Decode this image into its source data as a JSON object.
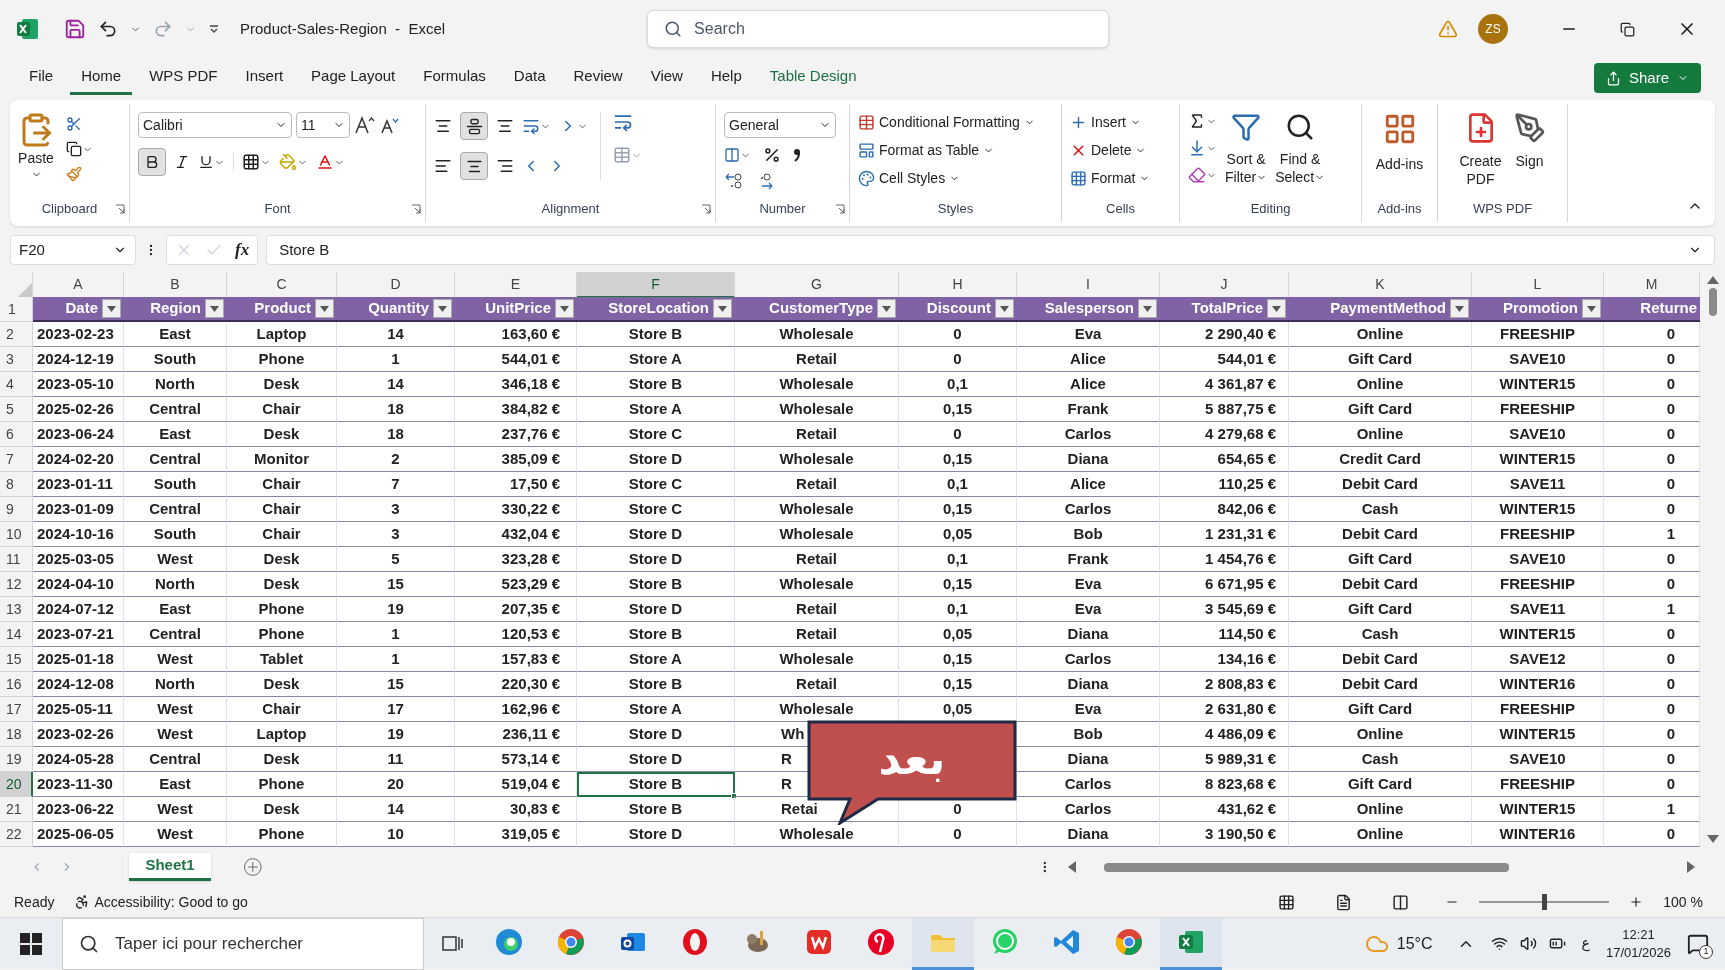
{
  "window": {
    "title": "Product-Sales-Region  -  Excel"
  },
  "search": {
    "placeholder": "Search"
  },
  "account": {
    "initials": "ZS"
  },
  "menu_tabs": [
    {
      "label": "File",
      "selected": false,
      "contextual": false
    },
    {
      "label": "Home",
      "selected": true,
      "contextual": false
    },
    {
      "label": "WPS PDF",
      "selected": false,
      "contextual": false
    },
    {
      "label": "Insert",
      "selected": false,
      "contextual": false
    },
    {
      "label": "Page Layout",
      "selected": false,
      "contextual": false
    },
    {
      "label": "Formulas",
      "selected": false,
      "contextual": false
    },
    {
      "label": "Data",
      "selected": false,
      "contextual": false
    },
    {
      "label": "Review",
      "selected": false,
      "contextual": false
    },
    {
      "label": "View",
      "selected": false,
      "contextual": false
    },
    {
      "label": "Help",
      "selected": false,
      "contextual": false
    },
    {
      "label": "Table Design",
      "selected": false,
      "contextual": true
    }
  ],
  "share_button": "Share",
  "ribbon": {
    "clipboard": {
      "paste": "Paste",
      "label": "Clipboard"
    },
    "font": {
      "name": "Calibri",
      "size": "11",
      "bold": true,
      "label": "Font"
    },
    "alignment": {
      "middle": true,
      "center": true,
      "label": "Alignment"
    },
    "number": {
      "format": "General",
      "label": "Number"
    },
    "styles": {
      "items": [
        "Conditional Formatting",
        "Format as Table",
        "Cell Styles"
      ],
      "label": "Styles"
    },
    "cells": {
      "items": [
        "Insert",
        "Delete",
        "Format"
      ],
      "label": "Cells"
    },
    "editing": {
      "sort": [
        "Sort &",
        "Filter"
      ],
      "find": [
        "Find &",
        "Select"
      ],
      "label": "Editing"
    },
    "addins": {
      "button": "Add-ins",
      "label": "Add-ins"
    },
    "wps_pdf": {
      "create": [
        "Create",
        "PDF"
      ],
      "sign": "Sign",
      "label": "WPS PDF"
    }
  },
  "formula_bar": {
    "name_box": "F20",
    "fx": "fx",
    "value": "Store B"
  },
  "sheet": {
    "columns": [
      {
        "letter": "A",
        "selected": false
      },
      {
        "letter": "B",
        "selected": false
      },
      {
        "letter": "C",
        "selected": false
      },
      {
        "letter": "D",
        "selected": false
      },
      {
        "letter": "E",
        "selected": false
      },
      {
        "letter": "F",
        "selected": true
      },
      {
        "letter": "G",
        "selected": false
      },
      {
        "letter": "H",
        "selected": false
      },
      {
        "letter": "I",
        "selected": false
      },
      {
        "letter": "J",
        "selected": false
      },
      {
        "letter": "K",
        "selected": false
      },
      {
        "letter": "L",
        "selected": false
      },
      {
        "letter": "M",
        "selected": false
      }
    ],
    "header_row_number": "1",
    "headers": [
      {
        "label": "Date",
        "filter": true
      },
      {
        "label": "Region",
        "filter": true
      },
      {
        "label": "Product",
        "filter": true
      },
      {
        "label": "Quantity",
        "filter": true
      },
      {
        "label": "UnitPrice",
        "filter": true
      },
      {
        "label": "StoreLocation",
        "filter": true
      },
      {
        "label": "CustomerType",
        "filter": true
      },
      {
        "label": "Discount",
        "filter": true
      },
      {
        "label": "Salesperson",
        "filter": true
      },
      {
        "label": "TotalPrice",
        "filter": true
      },
      {
        "label": "PaymentMethod",
        "filter": true
      },
      {
        "label": "Promotion",
        "filter": true
      },
      {
        "label": "Returne",
        "filter": false
      }
    ],
    "rows": [
      {
        "number": "2",
        "selected": false,
        "cells": [
          "2023-02-23",
          "East",
          "Laptop",
          "14",
          "163,60 €",
          "Store B",
          "Wholesale",
          "0",
          "Eva",
          "2 290,40 €",
          "Online",
          "FREESHIP",
          "0"
        ]
      },
      {
        "number": "3",
        "selected": false,
        "cells": [
          "2024-12-19",
          "South",
          "Phone",
          "1",
          "544,01 €",
          "Store A",
          "Retail",
          "0",
          "Alice",
          "544,01 €",
          "Gift Card",
          "SAVE10",
          "0"
        ]
      },
      {
        "number": "4",
        "selected": false,
        "cells": [
          "2023-05-10",
          "North",
          "Desk",
          "14",
          "346,18 €",
          "Store B",
          "Wholesale",
          "0,1",
          "Alice",
          "4 361,87 €",
          "Online",
          "WINTER15",
          "0"
        ]
      },
      {
        "number": "5",
        "selected": false,
        "cells": [
          "2025-02-26",
          "Central",
          "Chair",
          "18",
          "384,82 €",
          "Store A",
          "Wholesale",
          "0,15",
          "Frank",
          "5 887,75 €",
          "Gift Card",
          "FREESHIP",
          "0"
        ]
      },
      {
        "number": "6",
        "selected": false,
        "cells": [
          "2023-06-24",
          "East",
          "Desk",
          "18",
          "237,76 €",
          "Store C",
          "Retail",
          "0",
          "Carlos",
          "4 279,68 €",
          "Online",
          "SAVE10",
          "0"
        ]
      },
      {
        "number": "7",
        "selected": false,
        "cells": [
          "2024-02-20",
          "Central",
          "Monitor",
          "2",
          "385,09 €",
          "Store D",
          "Wholesale",
          "0,15",
          "Diana",
          "654,65 €",
          "Credit Card",
          "WINTER15",
          "0"
        ]
      },
      {
        "number": "8",
        "selected": false,
        "cells": [
          "2023-01-11",
          "South",
          "Chair",
          "7",
          "17,50 €",
          "Store C",
          "Retail",
          "0,1",
          "Alice",
          "110,25 €",
          "Debit Card",
          "SAVE11",
          "0"
        ]
      },
      {
        "number": "9",
        "selected": false,
        "cells": [
          "2023-01-09",
          "Central",
          "Chair",
          "3",
          "330,22 €",
          "Store C",
          "Wholesale",
          "0,15",
          "Carlos",
          "842,06 €",
          "Cash",
          "WINTER15",
          "0"
        ]
      },
      {
        "number": "10",
        "selected": false,
        "cells": [
          "2024-10-16",
          "South",
          "Chair",
          "3",
          "432,04 €",
          "Store D",
          "Wholesale",
          "0,05",
          "Bob",
          "1 231,31 €",
          "Debit Card",
          "FREESHIP",
          "1"
        ]
      },
      {
        "number": "11",
        "selected": false,
        "cells": [
          "2025-03-05",
          "West",
          "Desk",
          "5",
          "323,28 €",
          "Store D",
          "Retail",
          "0,1",
          "Frank",
          "1 454,76 €",
          "Gift Card",
          "SAVE10",
          "0"
        ]
      },
      {
        "number": "12",
        "selected": false,
        "cells": [
          "2024-04-10",
          "North",
          "Desk",
          "15",
          "523,29 €",
          "Store B",
          "Wholesale",
          "0,15",
          "Eva",
          "6 671,95 €",
          "Debit Card",
          "FREESHIP",
          "0"
        ]
      },
      {
        "number": "13",
        "selected": false,
        "cells": [
          "2024-07-12",
          "East",
          "Phone",
          "19",
          "207,35 €",
          "Store D",
          "Retail",
          "0,1",
          "Eva",
          "3 545,69 €",
          "Gift Card",
          "SAVE11",
          "1"
        ]
      },
      {
        "number": "14",
        "selected": false,
        "cells": [
          "2023-07-21",
          "Central",
          "Phone",
          "1",
          "120,53 €",
          "Store B",
          "Retail",
          "0,05",
          "Diana",
          "114,50 €",
          "Cash",
          "WINTER15",
          "0"
        ]
      },
      {
        "number": "15",
        "selected": false,
        "cells": [
          "2025-01-18",
          "West",
          "Tablet",
          "1",
          "157,83 €",
          "Store A",
          "Wholesale",
          "0,15",
          "Carlos",
          "134,16 €",
          "Debit Card",
          "SAVE12",
          "0"
        ]
      },
      {
        "number": "16",
        "selected": false,
        "cells": [
          "2024-12-08",
          "North",
          "Desk",
          "15",
          "220,30 €",
          "Store B",
          "Retail",
          "0,15",
          "Diana",
          "2 808,83 €",
          "Debit Card",
          "WINTER16",
          "0"
        ]
      },
      {
        "number": "17",
        "selected": false,
        "cells": [
          "2025-05-11",
          "West",
          "Chair",
          "17",
          "162,96 €",
          "Store A",
          "Wholesale",
          "0,05",
          "Eva",
          "2 631,80 €",
          "Gift Card",
          "FREESHIP",
          "0"
        ]
      },
      {
        "number": "18",
        "selected": false,
        "cells": [
          "2023-02-26",
          "West",
          "Laptop",
          "19",
          "236,11 €",
          "Store D",
          {
            "text": "Wh",
            "clipped": true
          },
          null,
          "Bob",
          "4 486,09 €",
          "Online",
          "WINTER15",
          "0"
        ]
      },
      {
        "number": "19",
        "selected": false,
        "cells": [
          "2024-05-28",
          "Central",
          "Desk",
          "11",
          "573,14 €",
          "Store D",
          {
            "text": "R",
            "clipped": true
          },
          null,
          "Diana",
          "5 989,31 €",
          "Cash",
          "SAVE10",
          "0"
        ]
      },
      {
        "number": "20",
        "selected": true,
        "cells": [
          "2023-11-30",
          "East",
          "Phone",
          "20",
          "519,04 €",
          "Store B",
          {
            "text": "R",
            "clipped": true
          },
          null,
          "Carlos",
          "8 823,68 €",
          "Gift Card",
          "FREESHIP",
          "0"
        ]
      },
      {
        "number": "21",
        "selected": false,
        "cells": [
          "2023-06-22",
          "West",
          "Desk",
          "14",
          "30,83 €",
          "Store B",
          {
            "text": "Retai",
            "clipped": true
          },
          "0",
          "Carlos",
          "431,62 €",
          "Online",
          "WINTER15",
          "1"
        ]
      },
      {
        "number": "22",
        "selected": false,
        "cells": [
          "2025-06-05",
          "West",
          "Phone",
          "10",
          "319,05 €",
          "Store D",
          "Wholesale",
          "0",
          "Diana",
          "3 190,50 €",
          "Online",
          "WINTER16",
          "0"
        ]
      }
    ]
  },
  "callout": {
    "text": "بعد"
  },
  "sheet_tabs": [
    {
      "label": "Sheet1",
      "selected": true
    }
  ],
  "status_bar": {
    "mode": "Ready",
    "accessibility": "Accessibility: Good to go",
    "zoom": "100 %",
    "zoom_slider": {
      "level": 0.5
    }
  },
  "taskbar": {
    "search_placeholder": "Taper ici pour rechercher",
    "apps": [
      {
        "kind": "edge",
        "running": false
      },
      {
        "kind": "chrome",
        "running": false
      },
      {
        "kind": "outlook",
        "running": false
      },
      {
        "kind": "opera",
        "running": false
      },
      {
        "kind": "gimp",
        "running": false
      },
      {
        "kind": "wps",
        "running": false
      },
      {
        "kind": "pinterest",
        "running": false
      },
      {
        "kind": "explorer",
        "running": true
      },
      {
        "kind": "whatsapp",
        "running": false
      },
      {
        "kind": "vscode",
        "running": false
      },
      {
        "kind": "chrome",
        "running": false
      },
      {
        "kind": "excel",
        "running": true
      }
    ],
    "temperature": "15°C",
    "language": "ع",
    "time": "12:21",
    "date": "17/01/2026",
    "notifications": "1"
  }
}
